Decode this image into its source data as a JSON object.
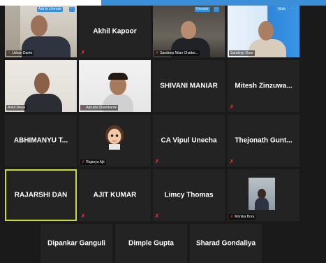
{
  "meeting": {
    "tiles_row1": [
      {
        "id": "t1",
        "label": "Ushan Dante",
        "tag": "Ask to Unmute",
        "dots": "···"
      },
      {
        "id": "t2",
        "name": "Akhil Kapoor"
      },
      {
        "id": "t3",
        "label": "Sandeep Nilan Chatter...",
        "tag": "Unmute",
        "dots": "···"
      },
      {
        "id": "t4",
        "label": "Sandeep Gaur",
        "tag": "Mute",
        "dots": "···"
      }
    ],
    "tiles_row2": [
      {
        "id": "t5",
        "label": "Ankit Desai"
      },
      {
        "id": "t6",
        "label": "Aarushi Dhamkarde"
      },
      {
        "id": "t7",
        "name": "SHIVANI MANIAR"
      },
      {
        "id": "t8",
        "name": "Mitesh  Zinzuwa..."
      }
    ],
    "tiles_row3": [
      {
        "id": "t9",
        "name": "ABHIMANYU  T..."
      },
      {
        "id": "t10",
        "label": "Rajanya Ajit"
      },
      {
        "id": "t11",
        "name": "CA Vipul Unecha"
      },
      {
        "id": "t12",
        "name": "Thejonath  Gunt..."
      }
    ],
    "tiles_row4": [
      {
        "id": "t13",
        "name": "RAJARSHI DAN"
      },
      {
        "id": "t14",
        "name": "AJIT KUMAR"
      },
      {
        "id": "t15",
        "name": "Limcy Thomas"
      },
      {
        "id": "t16",
        "label": "Monika Bora"
      }
    ],
    "tiles_row5": [
      {
        "id": "t17",
        "name": "Dipankar Ganguli"
      },
      {
        "id": "t18",
        "name": "Dimple Gupta"
      },
      {
        "id": "t19",
        "name": "Sharad Gondaliya"
      }
    ],
    "mic_muted_symbol": "✗",
    "top_tag_labels": {
      "ask_unmute": "Ask to Unmute",
      "unmute": "Unmute",
      "mute": "Mute",
      "more": "···"
    }
  },
  "colors": {
    "accent": "#3a8fd8",
    "active_speaker_border": "#c9dc3a",
    "mic_muted": "#e0323c",
    "tile_bg": "#232323"
  }
}
